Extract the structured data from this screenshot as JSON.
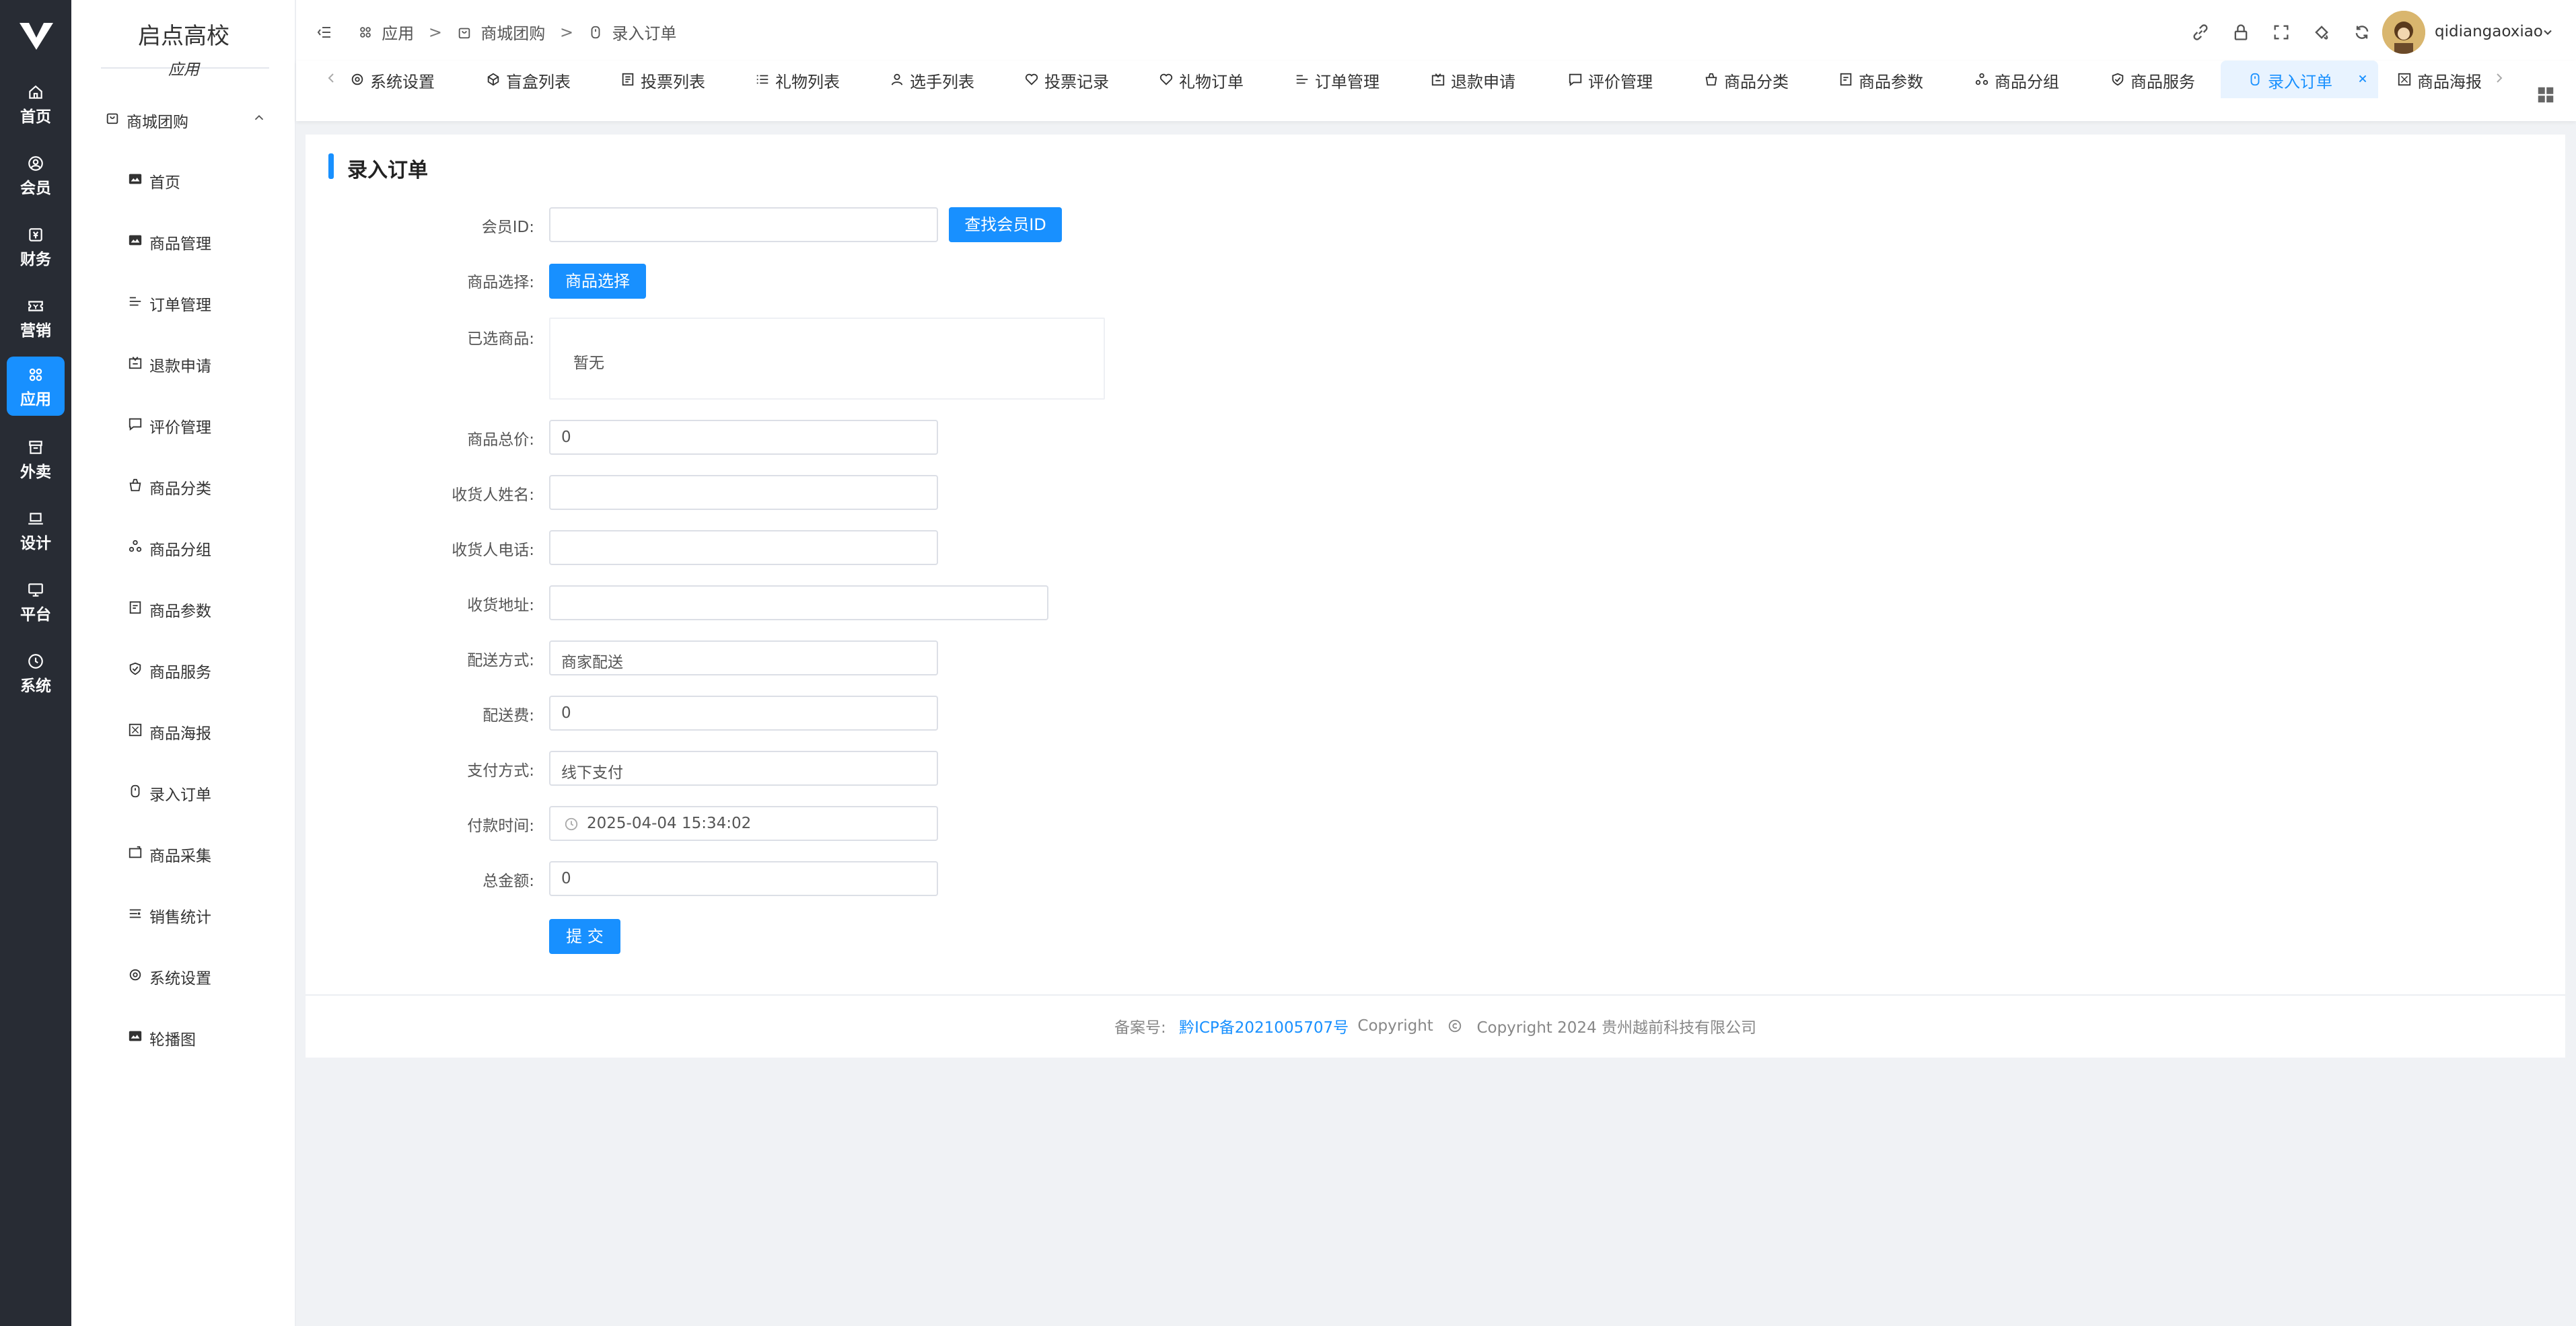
{
  "rail": {
    "items": [
      {
        "label": "首页",
        "icon": "home-icon"
      },
      {
        "label": "会员",
        "icon": "member-icon"
      },
      {
        "label": "财务",
        "icon": "finance-icon"
      },
      {
        "label": "营销",
        "icon": "marketing-icon"
      },
      {
        "label": "应用",
        "icon": "apps-icon",
        "active": true
      },
      {
        "label": "外卖",
        "icon": "takeout-icon"
      },
      {
        "label": "设计",
        "icon": "design-icon"
      },
      {
        "label": "平台",
        "icon": "platform-icon"
      },
      {
        "label": "系统",
        "icon": "system-icon"
      }
    ],
    "active_color": "#1890ff"
  },
  "sidebar": {
    "brand": "启点高校",
    "brand_sub": "应用",
    "group": "商城团购",
    "items": [
      {
        "label": "首页",
        "icon": "image-icon"
      },
      {
        "label": "商品管理",
        "icon": "image-icon"
      },
      {
        "label": "订单管理",
        "icon": "list-icon"
      },
      {
        "label": "退款申请",
        "icon": "refund-icon"
      },
      {
        "label": "评价管理",
        "icon": "comment-icon"
      },
      {
        "label": "商品分类",
        "icon": "category-icon"
      },
      {
        "label": "商品分组",
        "icon": "group-icon"
      },
      {
        "label": "商品参数",
        "icon": "params-icon"
      },
      {
        "label": "商品服务",
        "icon": "service-icon"
      },
      {
        "label": "商品海报",
        "icon": "poster-icon"
      },
      {
        "label": "录入订单",
        "icon": "entry-icon"
      },
      {
        "label": "商品采集",
        "icon": "collect-icon"
      },
      {
        "label": "销售统计",
        "icon": "stats-icon"
      },
      {
        "label": "系统设置",
        "icon": "settings-icon"
      },
      {
        "label": "轮播图",
        "icon": "image-icon"
      }
    ]
  },
  "header": {
    "breadcrumb": [
      "应用",
      "商城团购",
      "录入订单"
    ],
    "breadcrumb_sep": ">",
    "username": "qidiangaoxiao"
  },
  "tabs": {
    "items": [
      {
        "label": "系统设置",
        "icon": "settings-icon"
      },
      {
        "label": "盲盒列表",
        "icon": "box-icon"
      },
      {
        "label": "投票列表",
        "icon": "doc-icon"
      },
      {
        "label": "礼物列表",
        "icon": "list-icon"
      },
      {
        "label": "选手列表",
        "icon": "user-icon"
      },
      {
        "label": "投票记录",
        "icon": "heart-icon"
      },
      {
        "label": "礼物订单",
        "icon": "heart-icon"
      },
      {
        "label": "订单管理",
        "icon": "list-icon"
      },
      {
        "label": "退款申请",
        "icon": "refund-icon"
      },
      {
        "label": "评价管理",
        "icon": "comment-icon"
      },
      {
        "label": "商品分类",
        "icon": "category-icon"
      },
      {
        "label": "商品参数",
        "icon": "params-icon"
      },
      {
        "label": "商品分组",
        "icon": "group-icon"
      },
      {
        "label": "商品服务",
        "icon": "service-icon"
      },
      {
        "label": "录入订单",
        "icon": "entry-icon",
        "active": true
      },
      {
        "label": "商品海报",
        "icon": "poster-icon"
      }
    ]
  },
  "form": {
    "title": "录入订单",
    "member_id_label": "会员ID:",
    "member_id_value": "",
    "find_member_button": "查找会员ID",
    "product_select_label": "商品选择:",
    "product_select_button": "商品选择",
    "selected_label": "已选商品:",
    "selected_empty": "暂无",
    "total_price_label": "商品总价:",
    "total_price_value": "0",
    "receiver_name_label": "收货人姓名:",
    "receiver_name_value": "",
    "receiver_phone_label": "收货人电话:",
    "receiver_phone_value": "",
    "address_label": "收货地址:",
    "address_value": "",
    "delivery_label": "配送方式:",
    "delivery_value": "商家配送",
    "delivery_fee_label": "配送费:",
    "delivery_fee_value": "0",
    "payment_label": "支付方式:",
    "payment_value": "线下支付",
    "pay_time_label": "付款时间:",
    "pay_time_value": "2025-04-04 15:34:02",
    "amount_label": "总金额:",
    "amount_value": "0",
    "submit_button": "提 交"
  },
  "footer": {
    "record_label": "备案号:",
    "icp_link": "黔ICP备2021005707号",
    "copyright_word": "Copyright",
    "copyright_text": "Copyright 2024 贵州越前科技有限公司"
  }
}
